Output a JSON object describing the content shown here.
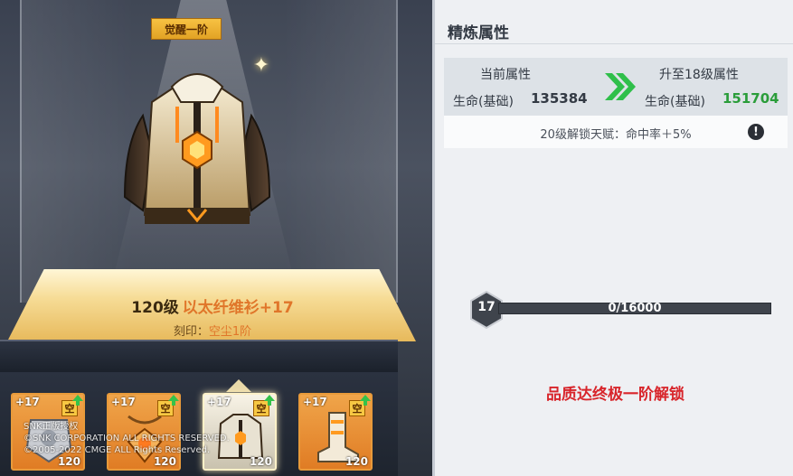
{
  "awaken_tag": "觉醒一阶",
  "item": {
    "level": "120级",
    "name": "以太纤维衫+17",
    "engrave_label": "刻印：",
    "engrave_value": "空尘1阶"
  },
  "slots": [
    {
      "plus": "+17",
      "badge": "空",
      "level": "120",
      "icon": "shield-gear-icon",
      "selected": false
    },
    {
      "plus": "+17",
      "badge": "空",
      "level": "120",
      "icon": "amulet-gear-icon",
      "selected": false
    },
    {
      "plus": "+17",
      "badge": "空",
      "level": "120",
      "icon": "jacket-gear-icon",
      "selected": true
    },
    {
      "plus": "+17",
      "badge": "空",
      "level": "120",
      "icon": "boots-gear-icon",
      "selected": false
    }
  ],
  "copyright": {
    "line1": "SNK正版授权",
    "line2": "©SNK CORPORATION ALL RIGHTS RESERVED.",
    "line3": "©2005-2022 CMGE ALL Rights Reserved."
  },
  "panel": {
    "title": "精炼属性",
    "current_header": "当前属性",
    "next_header": "升至18级属性",
    "current_label": "生命(基础)",
    "current_value": "135384",
    "next_label": "生命(基础)",
    "next_value": "151704",
    "talent_text": "20级解锁天赋：命中率＋5%",
    "level_badge": "17",
    "progress_text": "0/16000",
    "progress_fraction": 0,
    "unlock_text": "品质达终极一阶解锁"
  },
  "colors": {
    "accent_orange": "#e0762a",
    "value_green": "#2a9d3a",
    "unlock_red": "#d8252b",
    "tag_gold": "#f7c243"
  }
}
